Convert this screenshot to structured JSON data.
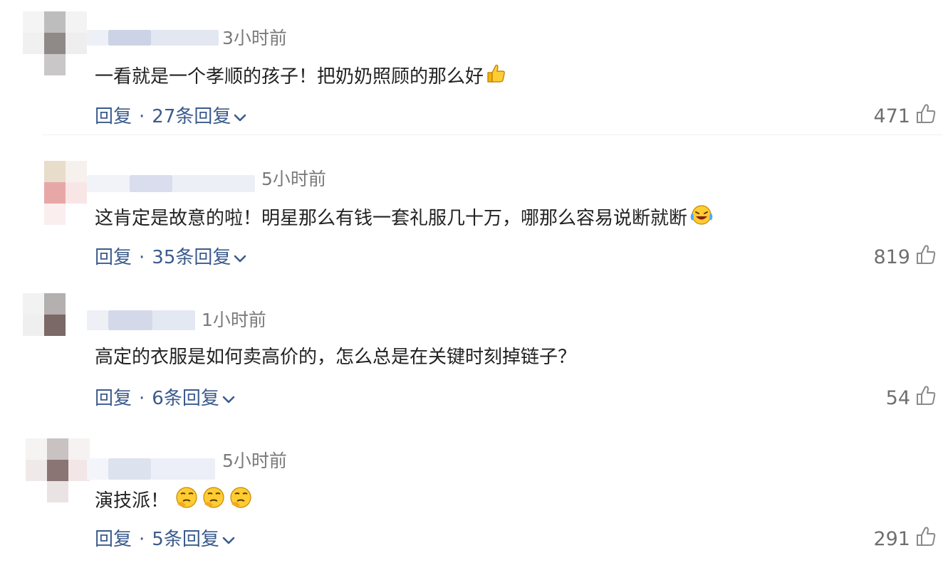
{
  "comments": [
    {
      "time": "3小时前",
      "text": "一看就是一个孝顺的孩子！把奶奶照顾的那么好",
      "emoji": "thumbs-up-emoji",
      "reply_label": "回复",
      "replies_label": "27条回复",
      "likes": "471"
    },
    {
      "time": "5小时前",
      "text": "这肯定是故意的啦！明星那么有钱一套礼服几十万，哪那么容易说断就断",
      "emoji": "laughing-crying-emoji",
      "reply_label": "回复",
      "replies_label": "35条回复",
      "likes": "819"
    },
    {
      "time": "1小时前",
      "text": "高定的衣服是如何卖高价的，怎么总是在关键时刻掉链子？",
      "emoji": "",
      "reply_label": "回复",
      "replies_label": "6条回复",
      "likes": "54"
    },
    {
      "time": "5小时前",
      "text": "演技派！",
      "emoji": "thinking-emoji x3",
      "reply_label": "回复",
      "replies_label": "5条回复",
      "likes": "291"
    }
  ],
  "separator": "·",
  "colors": {
    "link": "#3b5b8c",
    "meta": "#7a7a7a",
    "text": "#222222"
  }
}
